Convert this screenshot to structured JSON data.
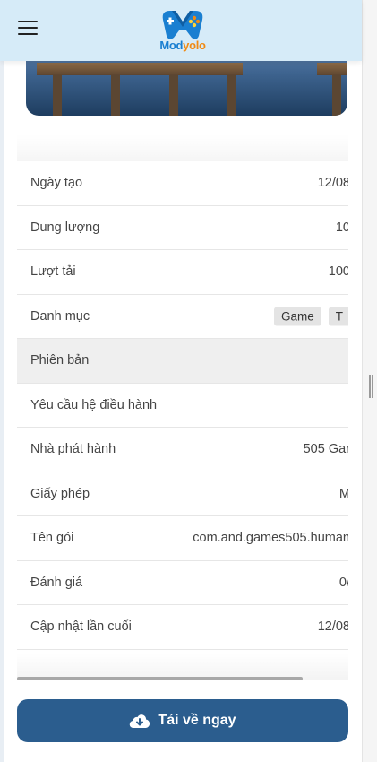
{
  "header": {
    "logo_mod": "Mod",
    "logo_yolo": "yolo",
    "menu_icon": "hamburger-icon"
  },
  "details": [
    {
      "label": "Ngày tạo",
      "value": "12/08"
    },
    {
      "label": "Dung lượng",
      "value": "10"
    },
    {
      "label": "Lượt tải",
      "value": "100"
    },
    {
      "label": "Danh mục",
      "tags": [
        "Game",
        "T"
      ]
    },
    {
      "label": "Phiên bản",
      "value": ""
    },
    {
      "label": "Yêu cầu hệ điều hành",
      "value": ""
    },
    {
      "label": "Nhà phát hành",
      "value": "505 Gar"
    },
    {
      "label": "Giấy phép",
      "value": "M"
    },
    {
      "label": "Tên gói",
      "value": "com.and.games505.human"
    },
    {
      "label": "Đánh giá",
      "value": "0/"
    },
    {
      "label": "Cập nhật lần cuối",
      "value": "12/08"
    }
  ],
  "download": {
    "label": "Tải về ngay",
    "icon": "cloud-download-icon"
  },
  "colors": {
    "header_bg": "#d6ebf8",
    "button_bg": "#2b5d8e",
    "logo_blue": "#1a7fd1",
    "logo_orange": "#f08a13"
  }
}
